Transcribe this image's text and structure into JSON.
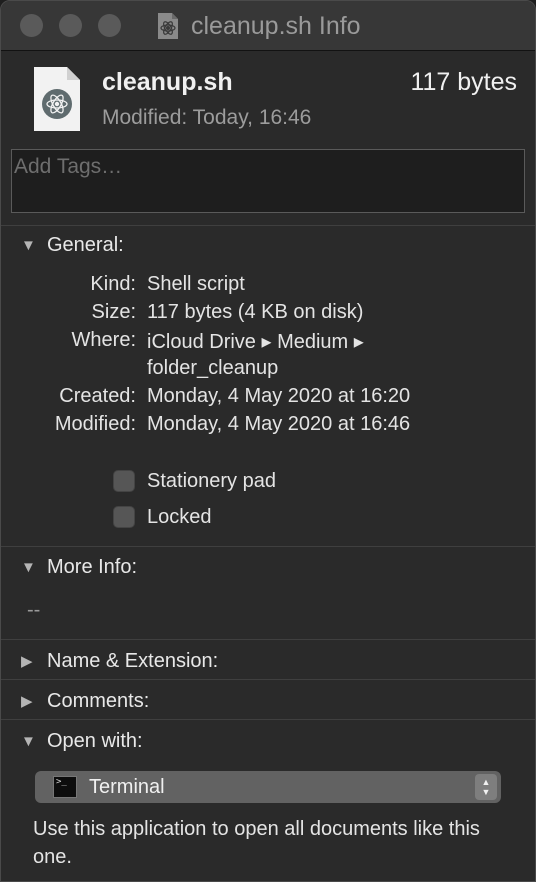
{
  "window": {
    "title": "cleanup.sh Info",
    "title_icon": "atom-script-icon"
  },
  "file": {
    "name": "cleanup.sh",
    "size": "117 bytes",
    "modified": "Modified: Today, 16:46"
  },
  "tags": {
    "placeholder": "Add Tags…",
    "value": ""
  },
  "general": {
    "title": "General:",
    "expanded": true,
    "rows": [
      {
        "label": "Kind:",
        "value": "Shell script"
      },
      {
        "label": "Size:",
        "value": "117 bytes (4 KB on disk)"
      },
      {
        "label": "Where:",
        "value": "iCloud Drive ▸ Medium ▸",
        "value2": "folder_cleanup"
      },
      {
        "label": "Created:",
        "value": "Monday, 4 May 2020 at 16:20"
      },
      {
        "label": "Modified:",
        "value": "Monday, 4 May 2020 at 16:46"
      }
    ],
    "stationery_label": "Stationery pad",
    "stationery_checked": false,
    "locked_label": "Locked",
    "locked_checked": false
  },
  "more_info": {
    "title": "More Info:",
    "expanded": true,
    "content": "--"
  },
  "name_extension": {
    "title": "Name & Extension:",
    "expanded": false
  },
  "comments": {
    "title": "Comments:",
    "expanded": false
  },
  "open_with": {
    "title": "Open with:",
    "expanded": true,
    "app": "Terminal",
    "description": "Use this application to open all documents like this one."
  },
  "colors": {
    "window_bg": "#2a2a2a",
    "titlebar_bg": "#373737",
    "text": "#e4e4e4",
    "muted_text": "#9c9c9c"
  }
}
